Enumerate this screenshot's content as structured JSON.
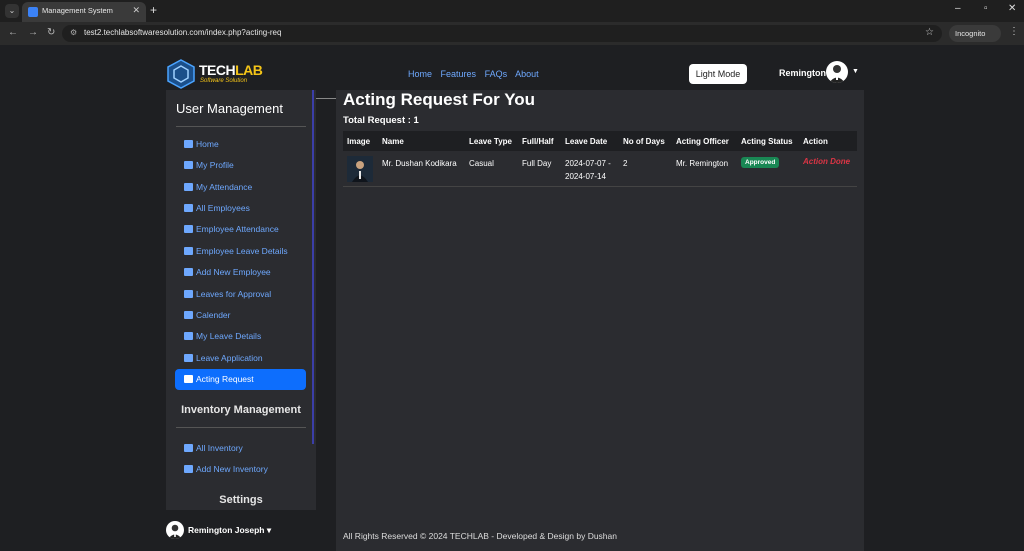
{
  "browser": {
    "tab_title": "Management System",
    "url": "test2.techlabsoftwaresolution.com/index.php?acting-req",
    "incognito_label": "Incognito"
  },
  "header": {
    "logo_main_a": "TECH",
    "logo_main_b": "LAB",
    "logo_sub": "Software Solution",
    "nav": [
      "Home",
      "Features",
      "FAQs",
      "About"
    ],
    "light_mode_label": "Light Mode",
    "user_name": "Remington"
  },
  "sidebar": {
    "title": "User Management",
    "items": [
      {
        "label": "Home",
        "icon": "home-icon"
      },
      {
        "label": "My Profile",
        "icon": "id-card-icon"
      },
      {
        "label": "My Attendance",
        "icon": "calendar-icon"
      },
      {
        "label": "All Employees",
        "icon": "user-icon"
      },
      {
        "label": "Employee Attendance",
        "icon": "user-icon"
      },
      {
        "label": "Employee Leave Details",
        "icon": "user-icon"
      },
      {
        "label": "Add New Employee",
        "icon": "user-plus-icon"
      },
      {
        "label": "Leaves for Approval",
        "icon": "approve-icon"
      },
      {
        "label": "Calender",
        "icon": "calendar-icon"
      },
      {
        "label": "My Leave Details",
        "icon": "table-icon"
      },
      {
        "label": "Leave Application",
        "icon": "file-icon"
      },
      {
        "label": "Acting Request",
        "icon": "users-gear-icon",
        "active": true
      }
    ],
    "inventory_title": "Inventory Management",
    "inventory_items": [
      {
        "label": "All Inventory",
        "icon": "building-icon"
      },
      {
        "label": "Add New Inventory",
        "icon": "building-plus-icon"
      }
    ],
    "settings_title": "Settings",
    "user_name": "Remington Joseph"
  },
  "main": {
    "title": "Acting Request For You",
    "total_label": "Total Request : 1",
    "columns": [
      "Image",
      "Name",
      "Leave Type",
      "Full/Half",
      "Leave Date",
      "No of Days",
      "Acting Officer",
      "Acting Status",
      "Action"
    ],
    "rows": [
      {
        "name": "Mr. Dushan Kodikara",
        "leave_type": "Casual",
        "full_half": "Full Day",
        "leave_date_from": "2024-07-07 -",
        "leave_date_to": "2024-07-14",
        "days": "2",
        "acting_officer": "Mr. Remington",
        "status": "Approved",
        "action": "Action Done"
      }
    ]
  },
  "footer": "All Rights Reserved © 2024 TECHLAB - Developed & Design by Dushan",
  "colors": {
    "accent": "#0d6efd",
    "link": "#6ea8fe",
    "approved": "#198754",
    "action_done": "#dc3545"
  }
}
